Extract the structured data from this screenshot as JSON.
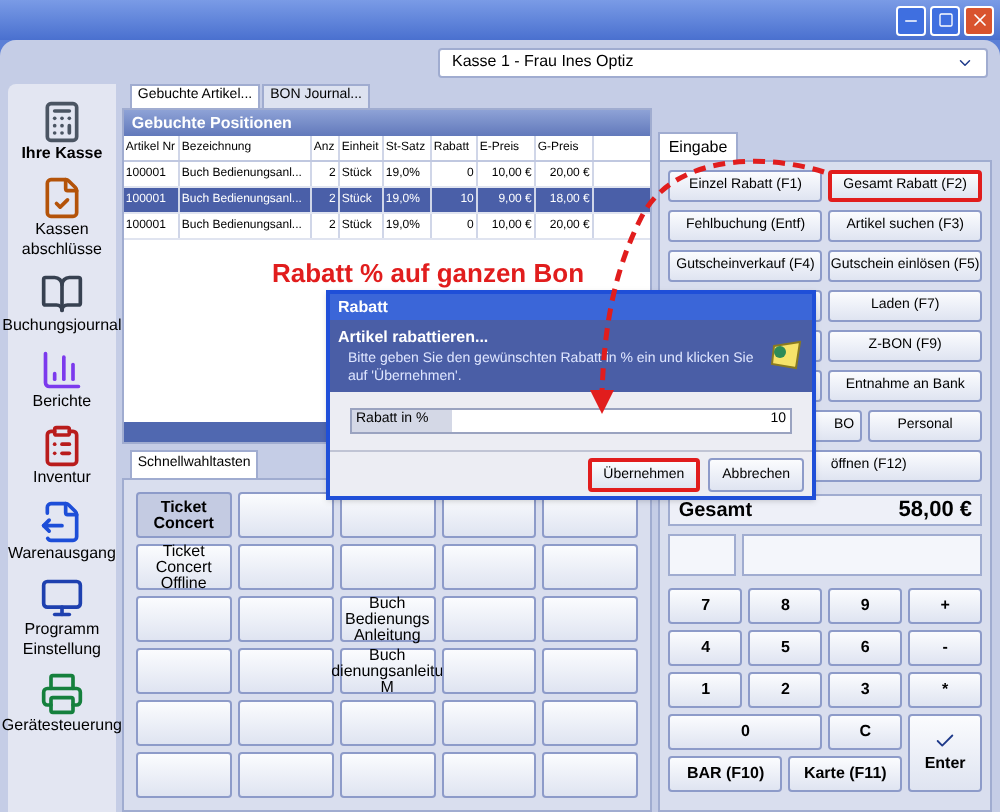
{
  "header": {
    "cashier_select": "Kasse 1 - Frau Ines Optiz"
  },
  "sidebar": {
    "items": [
      {
        "label": "Ihre Kasse",
        "selected": true
      },
      {
        "label": "Kassen abschlüsse",
        "selected": false
      },
      {
        "label": "Buchungsjournal",
        "selected": false
      },
      {
        "label": "Berichte",
        "selected": false
      },
      {
        "label": "Inventur",
        "selected": false
      },
      {
        "label": "Warenausgang",
        "selected": false
      },
      {
        "label": "Programm Einstellung",
        "selected": false
      },
      {
        "label": "Gerätesteuerung",
        "selected": false
      }
    ]
  },
  "center": {
    "tabs": [
      {
        "label": "Gebuchte Artikel...",
        "selected": true
      },
      {
        "label": "BON Journal...",
        "selected": false
      }
    ],
    "table": {
      "title": "Gebuchte Positionen",
      "columns": [
        "Artikel Nr",
        "Bezeichnung",
        "Anz",
        "Einheit",
        "St-Satz",
        "Rabatt",
        "E-Preis",
        "G-Preis"
      ],
      "rows": [
        {
          "cells": [
            "100001",
            "Buch Bedienungsanl...",
            "2",
            "Stück",
            "19,0%",
            "0",
            "10,00 €",
            "20,00 €"
          ],
          "selected": false
        },
        {
          "cells": [
            "100001",
            "Buch Bedienungsanl...",
            "2",
            "Stück",
            "19,0%",
            "10",
            "9,00 €",
            "18,00 €"
          ],
          "selected": true
        },
        {
          "cells": [
            "100001",
            "Buch Bedienungsanl...",
            "2",
            "Stück",
            "19,0%",
            "0",
            "10,00 €",
            "20,00 €"
          ],
          "selected": false
        }
      ]
    },
    "quick_tab": "Schnellwahltasten",
    "quick_keys": [
      {
        "kind": "bold",
        "label": "Ticket Concert"
      },
      {
        "kind": "empty"
      },
      {
        "kind": "empty"
      },
      {
        "kind": "empty"
      },
      {
        "kind": "empty"
      },
      {
        "kind": "plain",
        "label": "Ticket Concert Offline"
      },
      {
        "kind": "empty"
      },
      {
        "kind": "empty"
      },
      {
        "kind": "empty"
      },
      {
        "kind": "empty"
      },
      {
        "kind": "empty"
      },
      {
        "kind": "empty"
      },
      {
        "kind": "plain",
        "label": "Buch Bedienungs Anleitung"
      },
      {
        "kind": "empty"
      },
      {
        "kind": "empty"
      },
      {
        "kind": "empty"
      },
      {
        "kind": "empty"
      },
      {
        "kind": "plain",
        "label": "Buch dienungsanleitu M"
      },
      {
        "kind": "empty"
      },
      {
        "kind": "empty"
      },
      {
        "kind": "empty"
      },
      {
        "kind": "empty"
      },
      {
        "kind": "empty"
      },
      {
        "kind": "empty"
      },
      {
        "kind": "empty"
      },
      {
        "kind": "empty"
      },
      {
        "kind": "empty"
      },
      {
        "kind": "empty"
      },
      {
        "kind": "empty"
      },
      {
        "kind": "empty"
      }
    ]
  },
  "right": {
    "tab": "Eingabe",
    "buttons": [
      {
        "kind": "half",
        "label": "Einzel Rabatt (F1)",
        "highlighted": false
      },
      {
        "kind": "half",
        "label": "Gesamt Rabatt (F2)",
        "highlighted": true
      },
      {
        "kind": "half",
        "label": "Fehlbuchung (Entf)",
        "highlighted": false
      },
      {
        "kind": "half",
        "label": "Artikel suchen (F3)",
        "highlighted": false
      },
      {
        "kind": "half",
        "label": "Gutscheinverkauf (F4)",
        "highlighted": false
      },
      {
        "kind": "half",
        "label": "Gutschein einlösen (F5)",
        "highlighted": false
      },
      {
        "kind": "covered",
        "highlighted": false
      },
      {
        "kind": "half",
        "label": "Laden (F7)",
        "highlighted": false
      },
      {
        "kind": "covered",
        "highlighted": false
      },
      {
        "kind": "half",
        "label": "Z-BON (F9)",
        "highlighted": false
      },
      {
        "kind": "covered",
        "highlighted": false
      },
      {
        "kind": "half",
        "label": "Entnahme an Bank",
        "highlighted": false
      },
      {
        "kind": "broad",
        "label": "BO",
        "highlighted": false
      },
      {
        "kind": "narrow",
        "label": "Personal",
        "highlighted": false
      },
      {
        "kind": "full",
        "label": "öffnen (F12)",
        "highlighted": false
      }
    ],
    "total": {
      "label": "Gesamt",
      "value": "58,00 €"
    },
    "keys": [
      {
        "kind": "key",
        "label": "7"
      },
      {
        "kind": "key",
        "label": "8"
      },
      {
        "kind": "key",
        "label": "9"
      },
      {
        "kind": "key",
        "label": "+"
      },
      {
        "kind": "key",
        "label": "4"
      },
      {
        "kind": "key",
        "label": "5"
      },
      {
        "kind": "key",
        "label": "6"
      },
      {
        "kind": "key",
        "label": "-"
      },
      {
        "kind": "key",
        "label": "1"
      },
      {
        "kind": "key",
        "label": "2"
      },
      {
        "kind": "key",
        "label": "3"
      },
      {
        "kind": "key",
        "label": "*"
      },
      {
        "kind": "wide",
        "label": "0"
      },
      {
        "kind": "key",
        "label": "C"
      },
      {
        "kind": "enter",
        "label": "Enter"
      },
      {
        "kind": "half",
        "label": "BAR (F10)"
      },
      {
        "kind": "half",
        "label": "Karte (F11)"
      }
    ]
  },
  "dialog": {
    "title": "Rabatt",
    "heading": "Artikel rabattieren...",
    "text": "Bitte geben Sie den gewünschten Rabatt in % ein und klicken Sie auf 'Übernehmen'.",
    "field": {
      "label": "Rabatt in %",
      "value": "10"
    },
    "buttons": [
      {
        "label": "Übernehmen",
        "highlighted": true
      },
      {
        "label": "Abbrechen",
        "highlighted": false
      }
    ]
  },
  "annotation": "Rabatt % auf ganzen Bon"
}
